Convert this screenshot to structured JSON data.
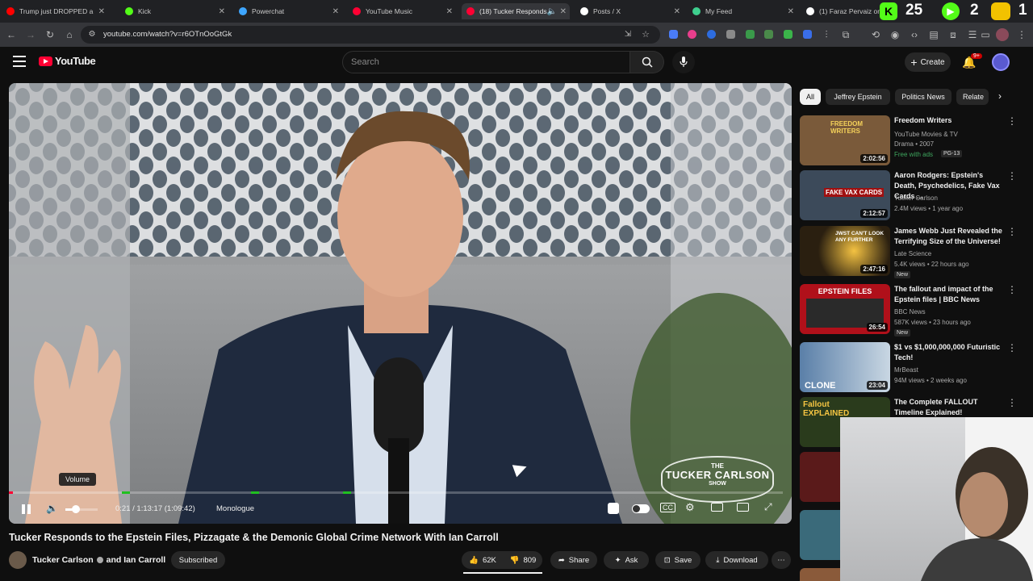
{
  "browser": {
    "tabs": [
      {
        "title": "Trump just DROPPED a",
        "color": "#ff0000"
      },
      {
        "title": "Kick",
        "color": "#53fc18"
      },
      {
        "title": "Powerchat",
        "color": "#3ea6ff"
      },
      {
        "title": "YouTube Music",
        "color": "#ff0033"
      },
      {
        "title": "(18) Tucker Responds",
        "color": "#ff0033",
        "active": true
      },
      {
        "title": "Posts / X",
        "color": "#ffffff"
      },
      {
        "title": "My Feed",
        "color": "#3ecf8e"
      },
      {
        "title": "(1) Faraz Pervaiz on X",
        "color": "#ffffff"
      }
    ],
    "url": "youtube.com/watch?v=r6OTnOoGtGk"
  },
  "overlay": {
    "counter_a": "25",
    "counter_b": "2",
    "counter_c": "1"
  },
  "header": {
    "logo_text": "YouTube",
    "search_placeholder": "Search",
    "create_label": "Create",
    "notif_badge": "9+"
  },
  "player": {
    "volume_tooltip": "Volume",
    "time": "0:21 / 1:13:17 (1:09:42)",
    "chapter": "Monologue",
    "progress": 0.005,
    "watermark_top": "THE",
    "watermark_main": "TUCKER CARLSON",
    "watermark_bottom": "SHOW"
  },
  "video": {
    "title": "Tucker Responds to the Epstein Files, Pizzagate & the Demonic Global Crime Network With Ian Carroll",
    "channel": "Tucker Carlson",
    "collab": "and Ian Carroll",
    "subscribed_label": "Subscribed",
    "likes": "62K",
    "dislikes": "809",
    "share_label": "Share",
    "ask_label": "Ask",
    "save_label": "Save",
    "download_label": "Download"
  },
  "chips": [
    "All",
    "Jeffrey Epstein",
    "Politics News",
    "Relate"
  ],
  "recommendations": [
    {
      "title": "Freedom Writers",
      "channel": "YouTube Movies & TV",
      "meta": "Drama • 2007",
      "extra": "Free with ads",
      "rating": "PG-13",
      "duration": "2:02:56",
      "thumb_color": "#7a5a3a",
      "thumb_text": "FREEDOM WRITERS"
    },
    {
      "title": "Aaron Rodgers: Epstein's Death, Psychedelics, Fake Vax Cards ...",
      "channel": "Tucker Carlson",
      "meta": "2.4M views • 1 year ago",
      "duration": "2:12:57",
      "thumb_color": "#3c4a5a",
      "thumb_text": "FAKE VAX CARDS"
    },
    {
      "title": "James Webb Just Revealed the Terrifying Size of the Universe!",
      "channel": "Late Science",
      "meta": "5.4K views • 22 hours ago",
      "badge": "New",
      "duration": "2:47:16",
      "thumb_color": "#2a1f10",
      "thumb_text": "JWST CAN'T LOOK ANY FURTHER"
    },
    {
      "title": "The fallout and impact of the Epstein files | BBC News",
      "channel": "BBC News",
      "meta": "587K views • 23 hours ago",
      "badge": "New",
      "duration": "26:54",
      "thumb_color": "#b0101a",
      "thumb_text": "EPSTEIN FILES"
    },
    {
      "title": "$1 vs $1,000,000,000 Futuristic Tech!",
      "channel": "MrBeast",
      "meta": "94M views • 2 weeks ago",
      "duration": "23:04",
      "thumb_color": "#5a7fa8",
      "thumb_text": "CLONE"
    },
    {
      "title": "The Complete FALLOUT Timeline Explained!",
      "channel": "",
      "meta": "",
      "duration": "",
      "thumb_color": "#2a3b1c",
      "thumb_text": "Fallout EXPLAINED"
    }
  ]
}
